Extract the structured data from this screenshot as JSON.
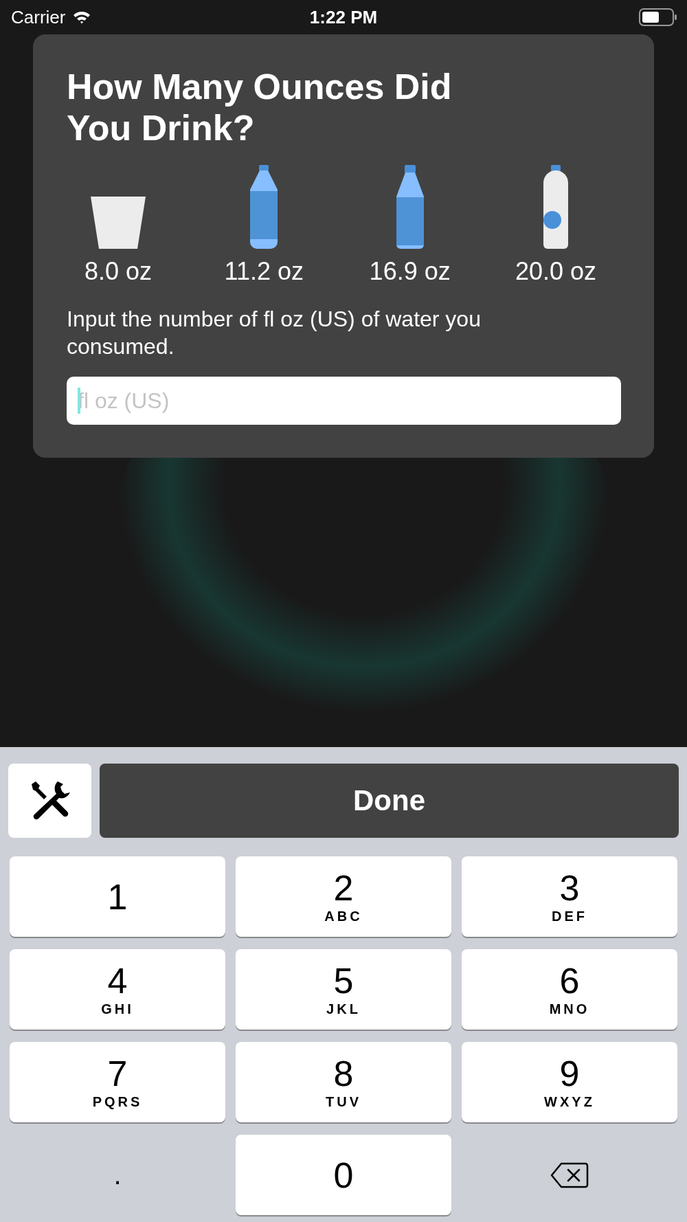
{
  "status_bar": {
    "carrier": "Carrier",
    "time": "1:22 PM"
  },
  "dialog": {
    "title": "How Many Ounces Did You Drink?",
    "presets": [
      {
        "kind": "cup",
        "label": "8.0 oz"
      },
      {
        "kind": "bottle",
        "label": "11.2 oz"
      },
      {
        "kind": "tall-bottle",
        "label": "16.9 oz"
      },
      {
        "kind": "white-bottle",
        "label": "20.0 oz"
      }
    ],
    "instruction": "Input the number of fl oz (US) of water you consumed.",
    "input": {
      "placeholder": "fl oz (US)",
      "focused": true
    }
  },
  "keyboard": {
    "done": "Done",
    "keys": [
      {
        "kind": "digit",
        "digit": "1"
      },
      {
        "kind": "digit",
        "digit": "2",
        "letters": "ABC"
      },
      {
        "kind": "digit",
        "digit": "3",
        "letters": "DEF"
      },
      {
        "kind": "digit",
        "digit": "4",
        "letters": "GHI"
      },
      {
        "kind": "digit",
        "digit": "5",
        "letters": "JKL"
      },
      {
        "kind": "digit",
        "digit": "6",
        "letters": "MNO"
      },
      {
        "kind": "digit",
        "digit": "7",
        "letters": "PQRS"
      },
      {
        "kind": "digit",
        "digit": "8",
        "letters": "TUV"
      },
      {
        "kind": "digit",
        "digit": "9",
        "letters": "WXYZ"
      },
      {
        "kind": "symbol",
        "digit": "."
      },
      {
        "kind": "digit",
        "digit": "0"
      },
      {
        "kind": "delete"
      }
    ]
  }
}
